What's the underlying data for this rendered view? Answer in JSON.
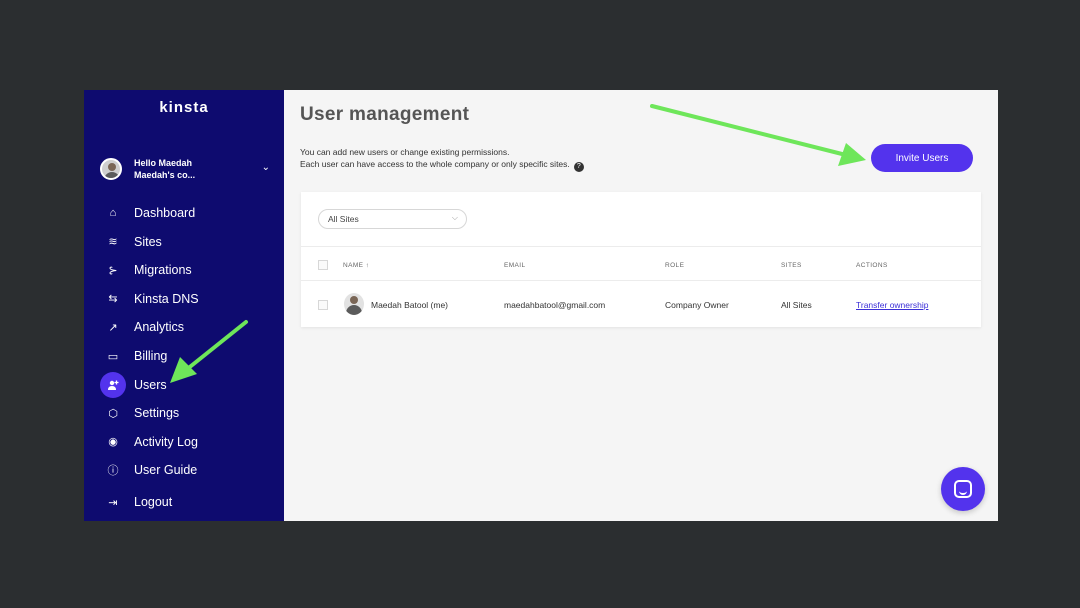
{
  "sidebar": {
    "logo": "kinsta",
    "user": {
      "greeting": "Hello Maedah",
      "company": "Maedah's co..."
    },
    "items": [
      {
        "label": "Dashboard",
        "icon": "home-icon"
      },
      {
        "label": "Sites",
        "icon": "layers-icon"
      },
      {
        "label": "Migrations",
        "icon": "migrations-icon"
      },
      {
        "label": "Kinsta DNS",
        "icon": "dns-icon"
      },
      {
        "label": "Analytics",
        "icon": "analytics-icon"
      },
      {
        "label": "Billing",
        "icon": "billing-icon"
      },
      {
        "label": "Users",
        "icon": "add-user-icon",
        "active": true
      },
      {
        "label": "Settings",
        "icon": "settings-icon"
      },
      {
        "label": "Activity Log",
        "icon": "eye-icon"
      },
      {
        "label": "User Guide",
        "icon": "info-icon"
      },
      {
        "label": "Logout",
        "icon": "logout-icon"
      }
    ]
  },
  "main": {
    "title": "User management",
    "desc_line1": "You can add new users or change existing permissions.",
    "desc_line2": "Each user can have access to the whole company or only specific sites.",
    "invite_label": "Invite Users",
    "filter_value": "All Sites",
    "table": {
      "headers": {
        "name": "NAME ↑",
        "email": "EMAIL",
        "role": "ROLE",
        "sites": "SITES",
        "actions": "ACTIONS"
      },
      "rows": [
        {
          "name": "Maedah Batool (me)",
          "email": "maedahbatool@gmail.com",
          "role": "Company Owner",
          "sites": "All Sites",
          "action": "Transfer ownership"
        }
      ]
    }
  },
  "colors": {
    "sidebar_bg": "#0e0b6f",
    "accent": "#5333ed",
    "annotation_arrow": "#6ee65a"
  }
}
